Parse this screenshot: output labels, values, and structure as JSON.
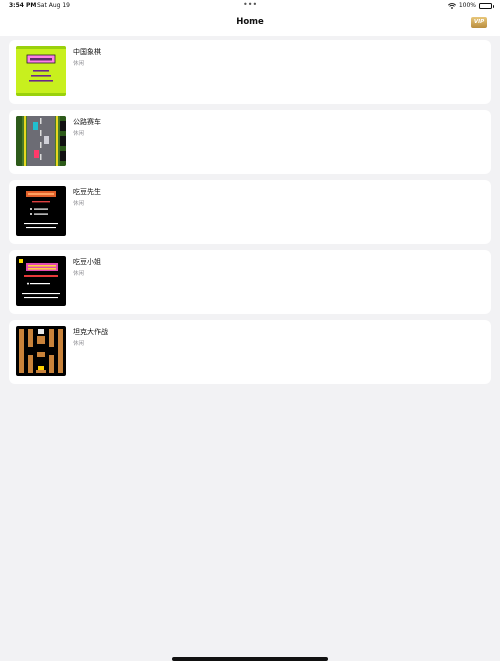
{
  "status_bar": {
    "time": "3:54 PM",
    "date": "Sat Aug 19",
    "battery": "100%"
  },
  "nav": {
    "title": "Home",
    "vip_label": "VIP"
  },
  "games": [
    {
      "title": "中国象棋",
      "category": "休闲"
    },
    {
      "title": "公路赛车",
      "category": "休闲"
    },
    {
      "title": "吃豆先生",
      "category": "休闲"
    },
    {
      "title": "吃豆小姐",
      "category": "休闲"
    },
    {
      "title": "坦克大作战",
      "category": "休闲"
    }
  ]
}
